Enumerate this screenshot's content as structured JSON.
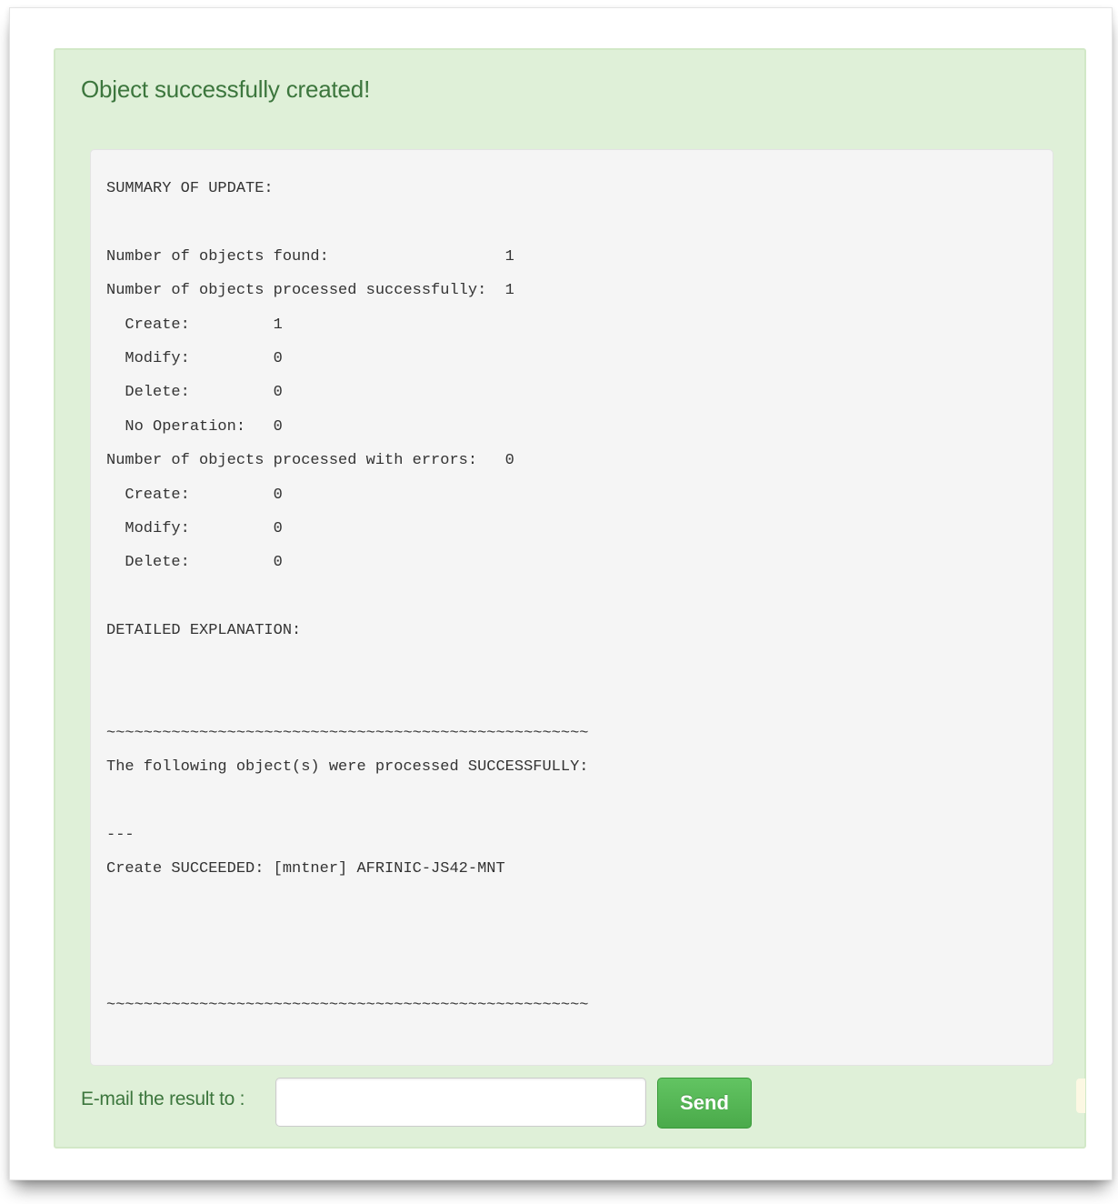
{
  "alert": {
    "title": "Object successfully created!"
  },
  "result": {
    "lines": [
      "SUMMARY OF UPDATE:",
      "",
      "Number of objects found:                   1",
      "Number of objects processed successfully:  1",
      "  Create:         1",
      "  Modify:         0",
      "  Delete:         0",
      "  No Operation:   0",
      "Number of objects processed with errors:   0",
      "  Create:         0",
      "  Modify:         0",
      "  Delete:         0",
      "",
      "DETAILED EXPLANATION:",
      "",
      "",
      "~~~~~~~~~~~~~~~~~~~~~~~~~~~~~~~~~~~~~~~~~~~~~~~~~~~~",
      "The following object(s) were processed SUCCESSFULLY:",
      "",
      "---",
      "Create SUCCEEDED: [mntner] AFRINIC-JS42-MNT",
      "",
      "",
      "",
      "~~~~~~~~~~~~~~~~~~~~~~~~~~~~~~~~~~~~~~~~~~~~~~~~~~~~"
    ]
  },
  "email": {
    "label": "E-mail the result to :",
    "value": "",
    "placeholder": ""
  },
  "send_button": {
    "label": "Send"
  },
  "colors": {
    "alert_background": "#dff0d8",
    "alert_text": "#3c763d",
    "result_background": "#f5f5f5",
    "button_green": "#5cb85c"
  }
}
